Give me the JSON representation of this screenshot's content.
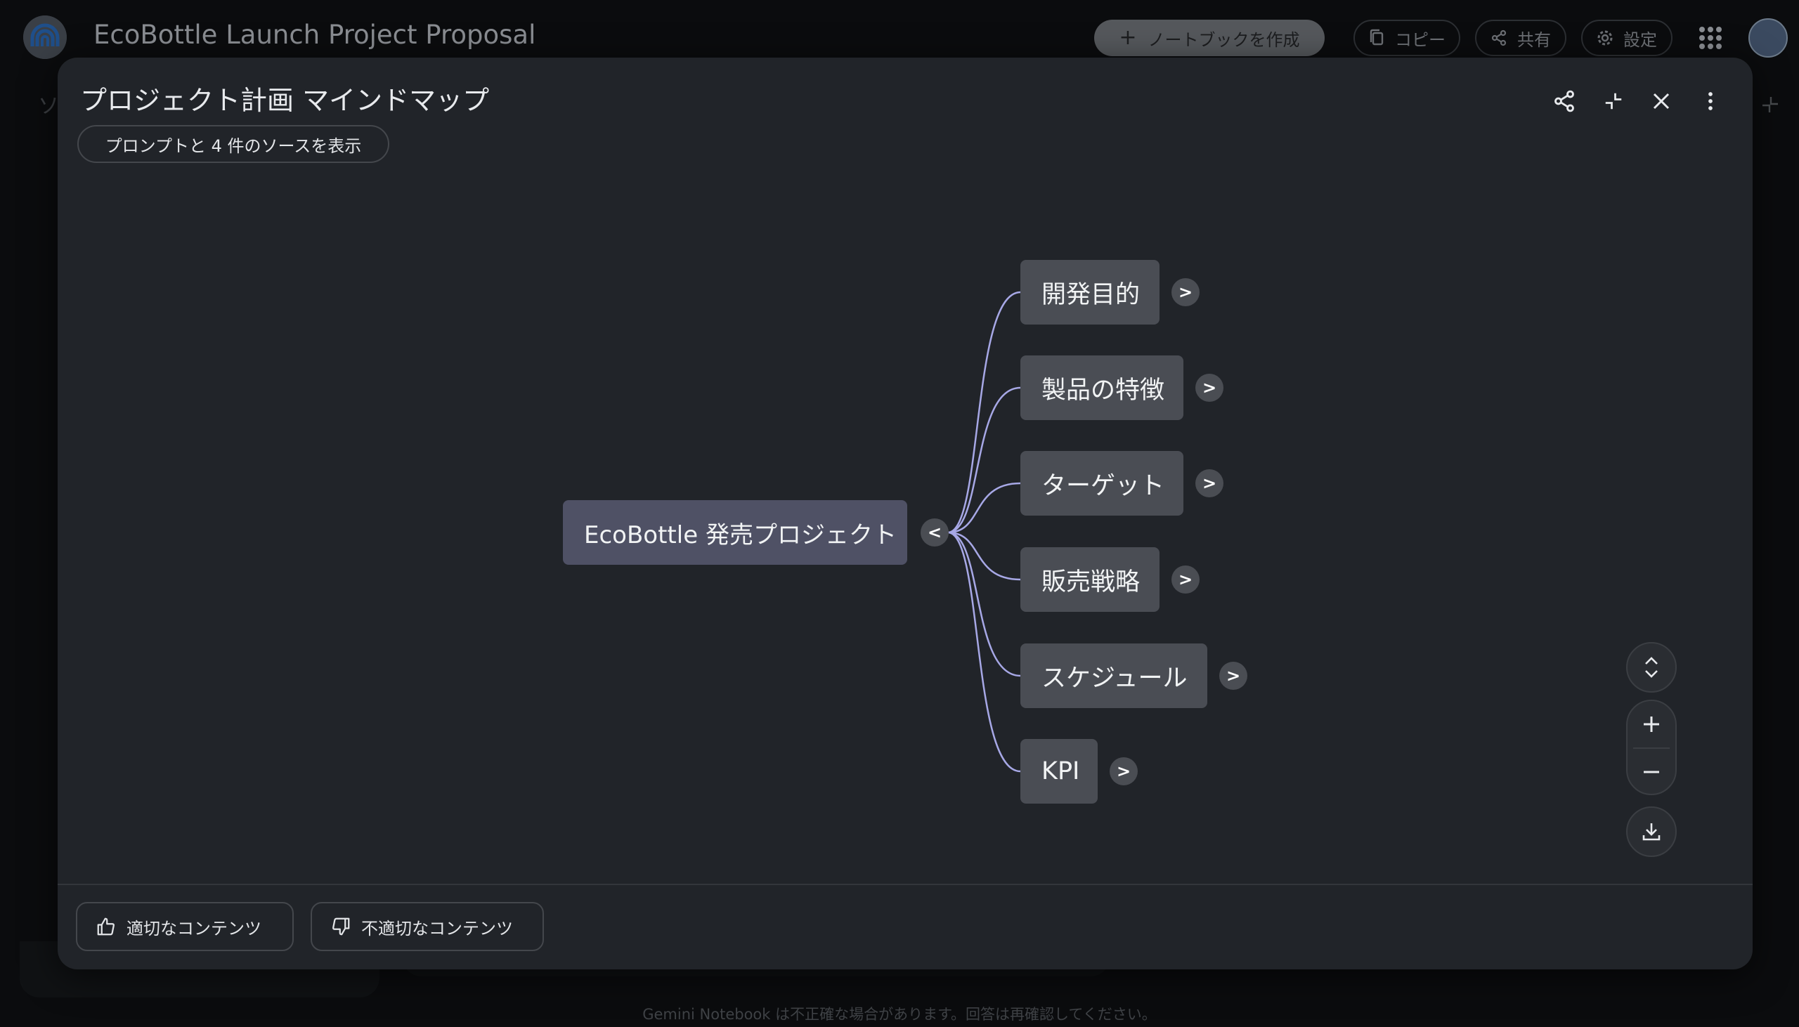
{
  "app": {
    "title": "EcoBottle Launch Project Proposal",
    "create_notebook_label": "ノートブックを作成",
    "copy_label": "コピー",
    "share_label": "共有",
    "settings_label": "設定",
    "footer_note": "Gemini Notebook は不正確な場合があります。回答は再確認してください。",
    "bg_glyph": "ソ"
  },
  "modal": {
    "title": "プロジェクト計画 マインドマップ",
    "sources_chip": "プロンプトと 4 件のソースを表示",
    "good_label": "適切なコンテンツ",
    "bad_label": "不適切なコンテンツ"
  },
  "mindmap": {
    "root": "EcoBottle 発売プロジェクト",
    "root_toggle": "<",
    "child_toggle": ">",
    "children": [
      "開発目的",
      "製品の特徴",
      "ターゲット",
      "販売戦略",
      "スケジュール",
      "KPI"
    ]
  },
  "colors": {
    "edge": "#a7a8e6",
    "node": "#4a4d54",
    "root_node": "#4f5165",
    "modal_bg": "#212429"
  }
}
